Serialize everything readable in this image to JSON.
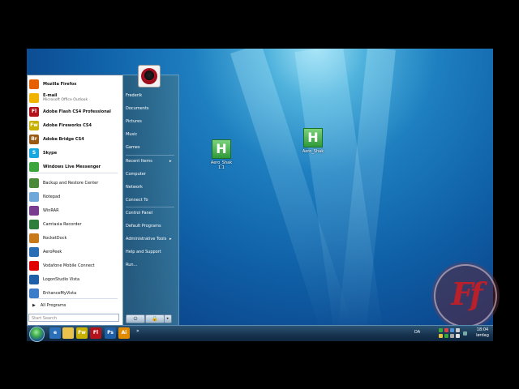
{
  "desktop": {
    "icons": [
      {
        "label": "Aero_Shak\n1.1"
      },
      {
        "label": "Aero_Shak"
      }
    ],
    "watermark": "Ff"
  },
  "start_menu": {
    "pinned": [
      {
        "label": "Mozilla Firefox",
        "icon": "firefox-icon",
        "color": "#e66000"
      },
      {
        "label": "E-mail",
        "sublabel": "Microsoft Office Outlook",
        "icon": "outlook-icon",
        "color": "#f0b400"
      },
      {
        "label": "Adobe Flash CS4 Professional",
        "icon": "flash-icon",
        "color": "#b3121a",
        "abbr": "Fl"
      },
      {
        "label": "Adobe Fireworks CS4",
        "icon": "fireworks-icon",
        "color": "#c8b000",
        "abbr": "Fw"
      },
      {
        "label": "Adobe Bridge CS4",
        "icon": "bridge-icon",
        "color": "#9a5a14",
        "abbr": "Br"
      },
      {
        "label": "Skype",
        "icon": "skype-icon",
        "color": "#14a7e0",
        "abbr": "S"
      },
      {
        "label": "Windows Live Messenger",
        "icon": "messenger-icon",
        "color": "#3aa53a"
      }
    ],
    "recent": [
      {
        "label": "Backup and Restore Center",
        "icon": "backup-icon",
        "color": "#4a8a3a"
      },
      {
        "label": "Notepad",
        "icon": "notepad-icon",
        "color": "#6ea7d8"
      },
      {
        "label": "WinRAR",
        "icon": "winrar-icon",
        "color": "#7a3c8e"
      },
      {
        "label": "Camtasia Recorder",
        "icon": "camtasia-icon",
        "color": "#2f7d3a"
      },
      {
        "label": "RocketDock",
        "icon": "rocketdock-icon",
        "color": "#c87a1a"
      },
      {
        "label": "AeroPeek",
        "icon": "aeropeek-icon",
        "color": "#2a6fb5"
      },
      {
        "label": "Vodafone Mobile Connect",
        "icon": "vodafone-icon",
        "color": "#e00000"
      },
      {
        "label": "LogonStudio Vista",
        "icon": "logonstudio-icon",
        "color": "#1e5fa8"
      },
      {
        "label": "EnhanceMyVista",
        "icon": "enhancemyvista-icon",
        "color": "#3d7cc9"
      }
    ],
    "all_programs": "All Programs",
    "search_placeholder": "Start Search",
    "right": {
      "user": "Frederik",
      "items": [
        "Documents",
        "Pictures",
        "Music",
        "Games",
        "Recent Items",
        "Computer",
        "Network",
        "Connect To",
        "Control Panel",
        "Default Programs",
        "Administrative Tools",
        "Help and Support",
        "Run..."
      ]
    }
  },
  "taskbar": {
    "apps": [
      {
        "icon": "ie-icon",
        "color": "#2b6fb8",
        "abbr": "e"
      },
      {
        "icon": "explorer-folder-icon",
        "color": "#e8c24a",
        "abbr": ""
      },
      {
        "icon": "fireworks-icon",
        "color": "#c8b000",
        "abbr": "Fw"
      },
      {
        "icon": "flash-icon",
        "color": "#b3121a",
        "abbr": "Fl"
      },
      {
        "icon": "photoshop-icon",
        "color": "#1f5fa8",
        "abbr": "Ps"
      },
      {
        "icon": "illustrator-icon",
        "color": "#e08a00",
        "abbr": "Ai"
      }
    ],
    "language": "DA",
    "time": "18:04",
    "day": "lørdag"
  }
}
